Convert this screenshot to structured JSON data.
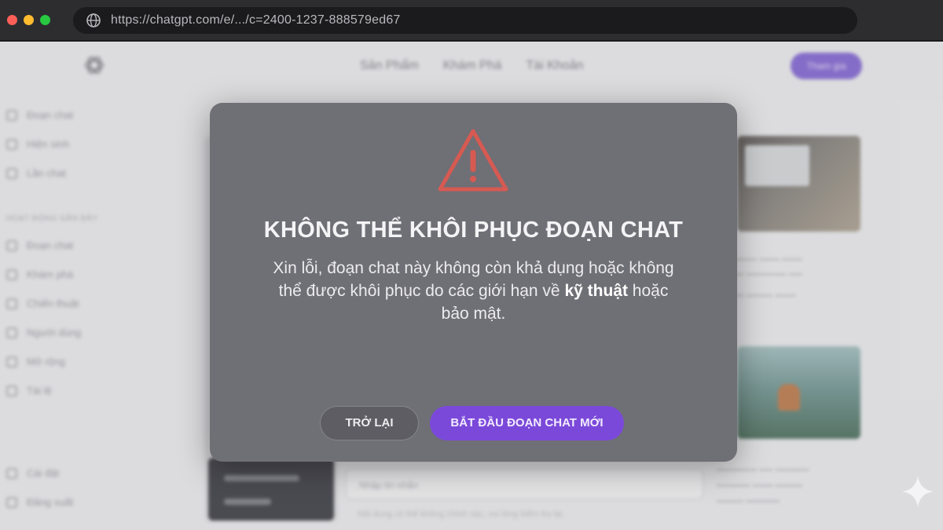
{
  "browser": {
    "url": "https://chatgpt.com/e/.../c=2400-1237-888579ed67"
  },
  "header": {
    "nav": [
      "Sản Phẩm",
      "Khám Phá",
      "Tài Khoản"
    ],
    "login_label": "Tham gia"
  },
  "sidebar": {
    "items_top": [
      "Đoạn chat",
      "Hiện sinh",
      "Lần chat"
    ],
    "section_label": "HOẠT ĐỘNG GẦN ĐÂY",
    "items_mid": [
      "Đoạn chat",
      "Khám phá",
      "Chiến thuật",
      "Người dùng",
      "Mở rộng",
      "Tài lệ"
    ],
    "items_bottom": [
      "Cài đặt",
      "Đăng xuất"
    ]
  },
  "background": {
    "dark_card_lines": [
      "Đoạn chat mới",
      "Tạo ảnh"
    ],
    "input_placeholder": "Nhập tin nhắn",
    "footnote": "Nội dung có thể không chính xác, vui lòng kiểm tra lại."
  },
  "modal": {
    "icon": "warning-triangle-icon",
    "title": "KHÔNG THỂ KHÔI PHỤC ĐOẠN CHAT",
    "body_line1": "Xin lỗi, đoạn chat này không còn khả dụng hoặc không",
    "body_line2_pre": "thể được khôi phục do các giới hạn về ",
    "body_bold": "kỹ thuật",
    "body_line2_post": " hoặc",
    "body_line3": "bảo mật.",
    "back_label": "TRỞ LẠI",
    "new_label": "BẮT ĐẦU ĐOẠN CHAT MỚI"
  },
  "colors": {
    "accent": "#7b49d9",
    "warning": "#d9534f",
    "modal_bg": "#6f6f76"
  }
}
